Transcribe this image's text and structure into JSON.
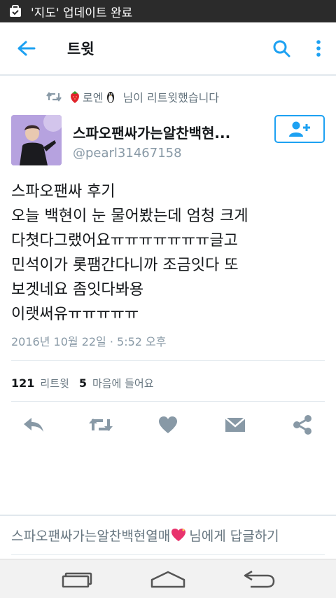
{
  "status_bar": {
    "notification_text": "'지도' 업데이트 완료"
  },
  "app_bar": {
    "title": "트윗"
  },
  "retweet_banner": {
    "retweeter": "로엔",
    "suffix": "님이 리트윗했습니다"
  },
  "tweet": {
    "author_name": "스파오팬싸가는알찬백현...",
    "author_handle": "@pearl31467158",
    "text_lines": [
      "스파오팬싸 후기",
      "오늘 백현이 눈 물어봤는데 엄청 크게",
      "다쳣다그랬어요ㅠㅠㅠㅠㅠㅠㅠ글고",
      "민석이가 롯팸간다니까 조금잇다 또",
      "보겟네요 좀잇다봐용",
      "이랫써유ㅠㅠㅠㅠㅠ"
    ],
    "timestamp": "2016년 10월 22일 · 5:52 오후",
    "retweet_count": "121",
    "retweet_label": "리트윗",
    "like_count": "5",
    "like_label": "마음에 들어요"
  },
  "reply_prompt": {
    "name": "스파오팬싸가는알찬백현열매",
    "suffix": "님에게 답글하기"
  },
  "colors": {
    "accent": "#1da1f2",
    "icon_gray": "#8899a6",
    "status_bar_bg": "#2b2b2b"
  }
}
